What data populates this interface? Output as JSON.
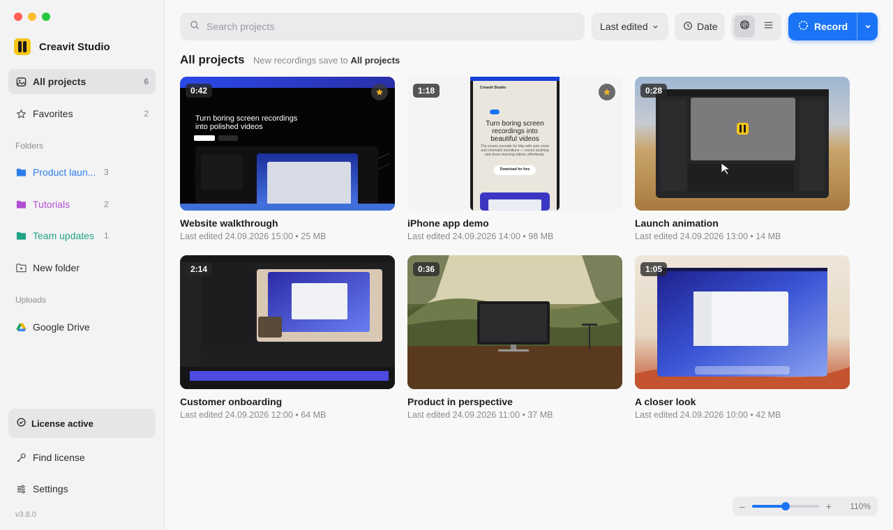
{
  "app": {
    "name": "Creavit Studio",
    "version": "v3.8.0"
  },
  "sidebar": {
    "nav": [
      {
        "label": "All projects",
        "count": "6",
        "icon": "photo-icon"
      },
      {
        "label": "Favorites",
        "count": "2",
        "icon": "star-icon"
      }
    ],
    "folders_label": "Folders",
    "folders": [
      {
        "label": "Product laun...",
        "count": "3",
        "color": "#2f7de8"
      },
      {
        "label": "Tutorials",
        "count": "2",
        "color": "#b04fd1"
      },
      {
        "label": "Team updates",
        "count": "1",
        "color": "#20a487"
      }
    ],
    "new_folder": "New folder",
    "uploads_label": "Uploads",
    "uploads": [
      {
        "label": "Google Drive",
        "icon": "google-drive-icon"
      }
    ],
    "license": "License active",
    "find_license": "Find license",
    "settings": "Settings"
  },
  "toolbar": {
    "search_placeholder": "Search projects",
    "sort_label": "Last edited",
    "date_label": "Date",
    "record_label": "Record"
  },
  "main": {
    "title": "All projects",
    "subtitle_prefix": "New recordings save to",
    "subtitle_target": "All projects"
  },
  "projects": [
    {
      "title": "Website walkthrough",
      "duration": "0:42",
      "meta": "Last edited 24.09.2026 15:00 • 25 MB",
      "favorite": true
    },
    {
      "title": "iPhone app demo",
      "duration": "1:18",
      "meta": "Last edited 24.09.2026 14:00 • 98 MB",
      "favorite": true
    },
    {
      "title": "Launch animation",
      "duration": "0:28",
      "meta": "Last edited 24.09.2026 13:00 • 14 MB",
      "favorite": false
    },
    {
      "title": "Customer onboarding",
      "duration": "2:14",
      "meta": "Last edited 24.09.2026 12:00 • 64 MB",
      "favorite": false
    },
    {
      "title": "Product in perspective",
      "duration": "0:36",
      "meta": "Last edited 24.09.2026 11:00 • 37 MB",
      "favorite": false
    },
    {
      "title": "A closer look",
      "duration": "1:05",
      "meta": "Last edited 24.09.2026 10:00 • 42 MB",
      "favorite": false
    }
  ],
  "thumb_text": {
    "web_headline": "Turn boring screen recordings into polished videos",
    "phone_brand": "Creavit Studio",
    "phone_headline": "Turn boring screen recordings into beautiful videos",
    "phone_body": "The screen recorder for Mac with auto zoom and cinematic transitions — record anything and share stunning videos, effortlessly.",
    "phone_cta": "Download for free"
  },
  "zoom": {
    "minus": "–",
    "plus": "+",
    "label": "110%",
    "value": 0.5
  },
  "colors": {
    "accent": "#1a74f5",
    "star": "#f0b429"
  }
}
